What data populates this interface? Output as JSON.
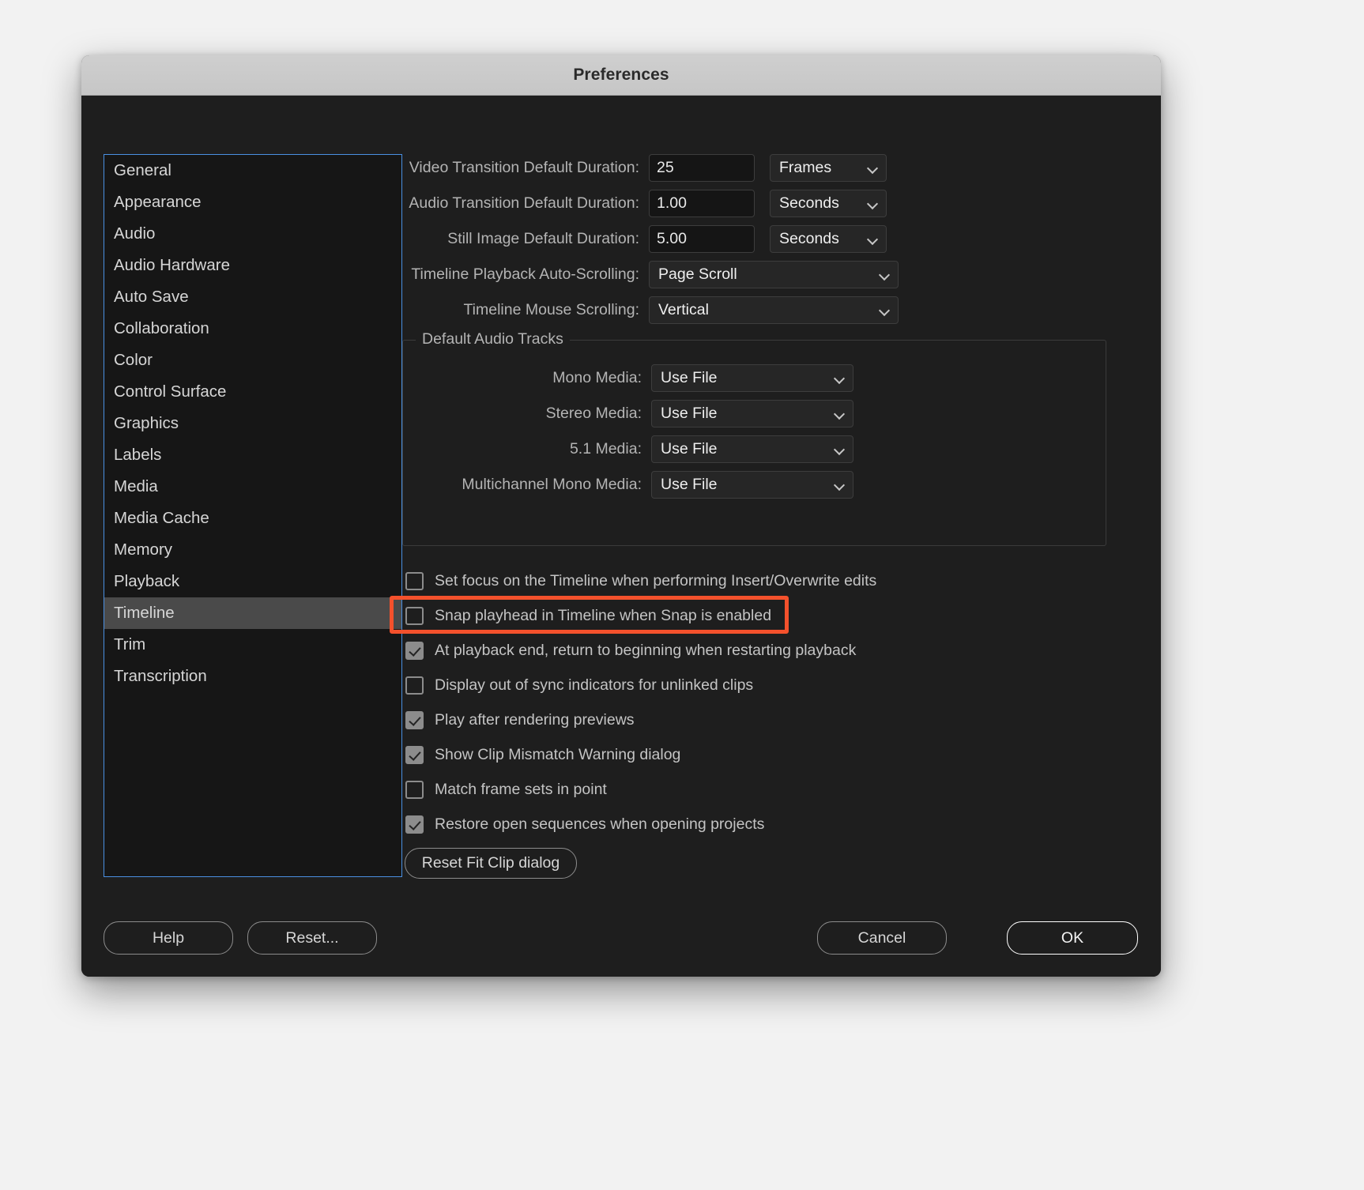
{
  "window": {
    "title": "Preferences"
  },
  "sidebar": {
    "items": [
      {
        "label": "General",
        "selected": false
      },
      {
        "label": "Appearance",
        "selected": false
      },
      {
        "label": "Audio",
        "selected": false
      },
      {
        "label": "Audio Hardware",
        "selected": false
      },
      {
        "label": "Auto Save",
        "selected": false
      },
      {
        "label": "Collaboration",
        "selected": false
      },
      {
        "label": "Color",
        "selected": false
      },
      {
        "label": "Control Surface",
        "selected": false
      },
      {
        "label": "Graphics",
        "selected": false
      },
      {
        "label": "Labels",
        "selected": false
      },
      {
        "label": "Media",
        "selected": false
      },
      {
        "label": "Media Cache",
        "selected": false
      },
      {
        "label": "Memory",
        "selected": false
      },
      {
        "label": "Playback",
        "selected": false
      },
      {
        "label": "Timeline",
        "selected": true
      },
      {
        "label": "Trim",
        "selected": false
      },
      {
        "label": "Transcription",
        "selected": false
      }
    ]
  },
  "main": {
    "duration_fields": [
      {
        "label": "Video Transition Default Duration:",
        "value": "25",
        "unit": "Frames"
      },
      {
        "label": "Audio Transition Default Duration:",
        "value": "1.00",
        "unit": "Seconds"
      },
      {
        "label": "Still Image Default Duration:",
        "value": "5.00",
        "unit": "Seconds"
      }
    ],
    "scroll_fields": [
      {
        "label": "Timeline Playback Auto-Scrolling:",
        "value": "Page Scroll"
      },
      {
        "label": "Timeline Mouse Scrolling:",
        "value": "Vertical"
      }
    ],
    "audio_group": {
      "title": "Default Audio Tracks",
      "rows": [
        {
          "label": "Mono Media:",
          "value": "Use File"
        },
        {
          "label": "Stereo Media:",
          "value": "Use File"
        },
        {
          "label": "5.1 Media:",
          "value": "Use File"
        },
        {
          "label": "Multichannel Mono Media:",
          "value": "Use File"
        }
      ]
    },
    "checkboxes": [
      {
        "label": "Set focus on the Timeline when performing Insert/Overwrite edits",
        "checked": false,
        "highlighted": false
      },
      {
        "label": "Snap playhead in Timeline when Snap is enabled",
        "checked": false,
        "highlighted": true
      },
      {
        "label": "At playback end, return to beginning when restarting playback",
        "checked": true,
        "highlighted": false
      },
      {
        "label": "Display out of sync indicators for unlinked clips",
        "checked": false,
        "highlighted": false
      },
      {
        "label": "Play after rendering previews",
        "checked": true,
        "highlighted": false
      },
      {
        "label": "Show Clip Mismatch Warning dialog",
        "checked": true,
        "highlighted": false
      },
      {
        "label": "Match frame sets in point",
        "checked": false,
        "highlighted": false
      },
      {
        "label": "Restore open sequences when opening projects",
        "checked": true,
        "highlighted": false
      }
    ],
    "reset_fit_clip_label": "Reset Fit Clip dialog"
  },
  "footer": {
    "help_label": "Help",
    "reset_label": "Reset...",
    "cancel_label": "Cancel",
    "ok_label": "OK"
  },
  "colors": {
    "highlight": "#f4512c",
    "focus_border": "#4a90e2",
    "selection": "#4a4a4a"
  }
}
